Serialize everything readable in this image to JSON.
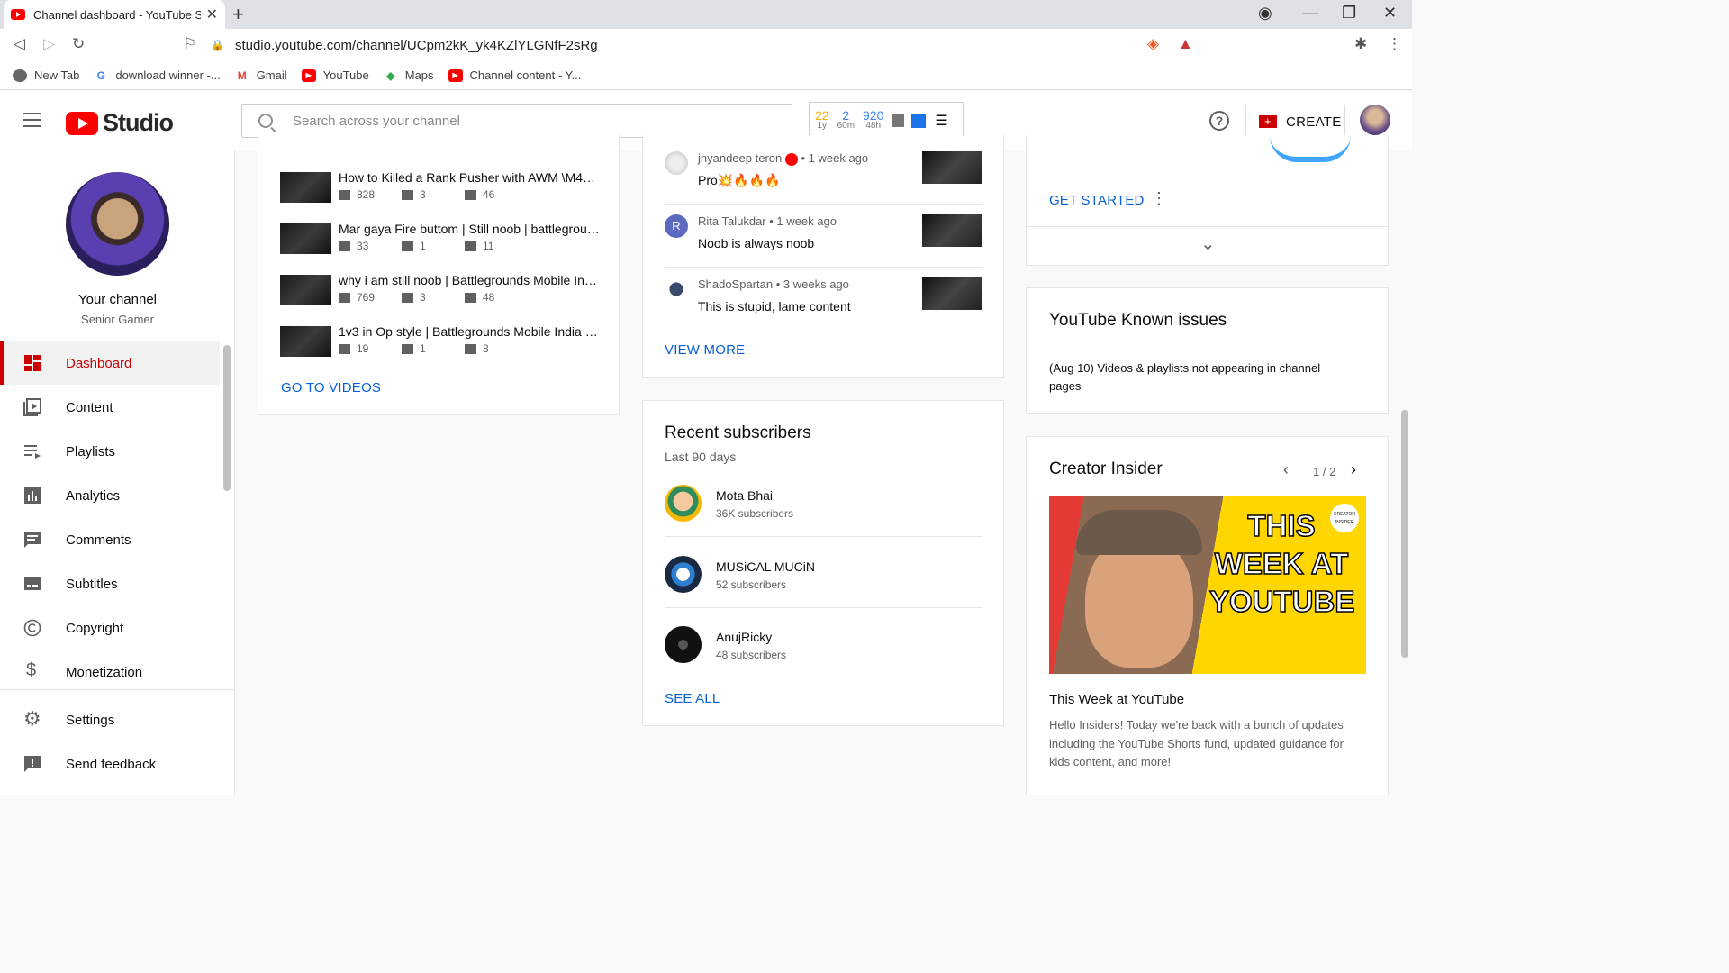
{
  "browser": {
    "tab_title": "Channel dashboard - YouTube Studio",
    "url": "studio.youtube.com/channel/UCpm2kK_yk4KZlYLGNfF2sRg",
    "bookmarks": [
      {
        "label": "New Tab"
      },
      {
        "label": "download winner -..."
      },
      {
        "label": "Gmail"
      },
      {
        "label": "YouTube"
      },
      {
        "label": "Maps"
      },
      {
        "label": "Channel content - Y..."
      }
    ]
  },
  "header": {
    "studio_label": "Studio",
    "search_placeholder": "Search across your channel",
    "ext_stats": [
      {
        "value": "22",
        "label": "1y",
        "color": "#f4b400"
      },
      {
        "value": "2",
        "label": "60m",
        "color": "#4285f4"
      },
      {
        "value": "920",
        "label": "48h",
        "color": "#4285f4"
      }
    ],
    "help": "?",
    "create_label": "CREATE"
  },
  "sidebar": {
    "channel_title": "Your channel",
    "channel_name": "Senior Gamer",
    "items": [
      {
        "label": "Dashboard",
        "icon": "dashboard-icon",
        "active": true
      },
      {
        "label": "Content",
        "icon": "content-icon"
      },
      {
        "label": "Playlists",
        "icon": "playlists-icon"
      },
      {
        "label": "Analytics",
        "icon": "analytics-icon"
      },
      {
        "label": "Comments",
        "icon": "comments-icon"
      },
      {
        "label": "Subtitles",
        "icon": "subtitles-icon"
      },
      {
        "label": "Copyright",
        "icon": "copyright-icon"
      },
      {
        "label": "Monetization",
        "icon": "monetization-icon"
      },
      {
        "label": "Settings",
        "icon": "settings-icon"
      },
      {
        "label": "Send feedback",
        "icon": "feedback-icon"
      }
    ]
  },
  "videos": {
    "items": [
      {
        "title": "How to Killed a Rank Pusher with AWM \\M416 ...",
        "views": "828",
        "comments": "3",
        "likes": "46"
      },
      {
        "title": "Mar gaya Fire buttom | Still noob | battleground...",
        "views": "33",
        "comments": "1",
        "likes": "11"
      },
      {
        "title": "why i am still noob | Battlegrounds Mobile Indi...",
        "views": "769",
        "comments": "3",
        "likes": "48"
      },
      {
        "title": "1v3 in Op style | Battlegrounds Mobile India | P...",
        "views": "19",
        "comments": "1",
        "likes": "8"
      }
    ],
    "go_to_videos": "GO TO VIDEOS"
  },
  "comments": {
    "items": [
      {
        "author": "jnyandeep teron",
        "time": "• 1 week ago",
        "text": "Pro💥🔥🔥🔥"
      },
      {
        "author": "Rita Talukdar",
        "time": "• 1 week ago",
        "text": "Noob is always noob",
        "initial": "R"
      },
      {
        "author": "ShadoSpartan",
        "time": "• 3 weeks ago",
        "text": "This is stupid, lame content"
      }
    ],
    "view_more": "VIEW MORE"
  },
  "subscribers": {
    "title": "Recent subscribers",
    "period": "Last 90 days",
    "items": [
      {
        "name": "Mota Bhai",
        "count": "36K subscribers"
      },
      {
        "name": "MUSiCAL MUCiN",
        "count": "52 subscribers"
      },
      {
        "name": "AnujRicky",
        "count": "48 subscribers"
      }
    ],
    "see_all": "SEE ALL"
  },
  "getting_started": {
    "button": "GET STARTED",
    "more": "⋮",
    "expand": "⌄"
  },
  "known_issues": {
    "title": "YouTube Known issues",
    "text": "(Aug 10) Videos & playlists not appearing in channel pages"
  },
  "creator_insider": {
    "title": "Creator Insider",
    "pager": "1 / 2",
    "thumb_text": "THIS WEEK AT YOUTUBE",
    "badge": "CREATOR INSIDER",
    "video_title": "This Week at YouTube",
    "description": "Hello Insiders! Today we're back with a bunch of updates including the YouTube Shorts fund, updated guidance for kids content, and more!"
  }
}
